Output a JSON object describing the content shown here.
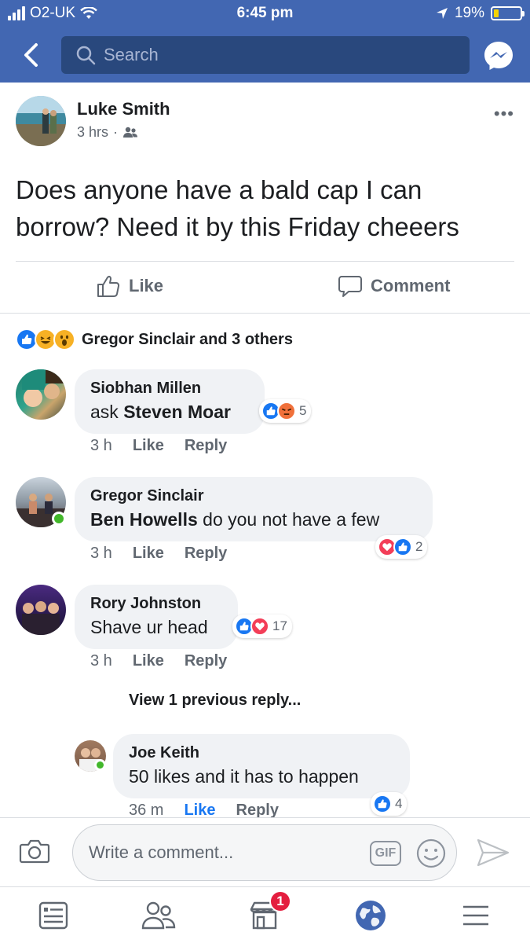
{
  "status_bar": {
    "carrier": "O2-UK",
    "time": "6:45 pm",
    "battery_percent": "19%",
    "battery_level": 0.19
  },
  "header": {
    "search_placeholder": "Search",
    "back_icon": "chevron-left-icon",
    "messenger_icon": "messenger-icon",
    "bg_color": "#4267b2"
  },
  "post": {
    "author": "Luke Smith",
    "time": "3 hrs",
    "separator": "·",
    "privacy_icon": "friends-icon",
    "text": "Does anyone have a bald cap I can borrow? Need it by this Friday cheeers",
    "more_icon": "more-icon"
  },
  "actions": {
    "like_label": "Like",
    "comment_label": "Comment"
  },
  "reactions_summary": {
    "icons": [
      "like",
      "haha",
      "wow"
    ],
    "text": "Gregor Sinclair and 3 others"
  },
  "comments": [
    {
      "author": "Siobhan Millen",
      "tag": "ask ",
      "mention": "Steven Moar",
      "rest": "",
      "time": "3 h",
      "like": "Like",
      "reply": "Reply",
      "reactions": [
        "like",
        "angry"
      ],
      "reaction_count": "5"
    },
    {
      "author": "Gregor Sinclair",
      "mention": "Ben Howells",
      "rest": " do you not have a few",
      "time": "3 h",
      "like": "Like",
      "reply": "Reply",
      "reactions": [
        "love",
        "like"
      ],
      "reaction_count": "2"
    },
    {
      "author": "Rory Johnston",
      "text": "Shave ur head",
      "time": "3 h",
      "like": "Like",
      "reply": "Reply",
      "reactions": [
        "like",
        "love"
      ],
      "reaction_count": "17"
    }
  ],
  "view_previous": "View 1 previous reply...",
  "reply": {
    "author": "Joe Keith",
    "text": "50 likes and it has to happen",
    "time": "36 m",
    "like": "Like",
    "reply": "Reply",
    "reactions": [
      "like"
    ],
    "reaction_count": "4"
  },
  "composer": {
    "placeholder": "Write a comment...",
    "gif_label": "GIF"
  },
  "tabbar": {
    "items": [
      "news-feed-icon",
      "friends-icon",
      "marketplace-icon",
      "notifications-globe-icon",
      "menu-icon"
    ],
    "marketplace_badge": "1"
  },
  "colors": {
    "facebook_blue": "#4267b2",
    "link_blue": "#1877f2",
    "like_blue": "#1877f2",
    "love_red": "#f33e58",
    "haha_yellow": "#f7b125",
    "online_green": "#42b72a"
  }
}
